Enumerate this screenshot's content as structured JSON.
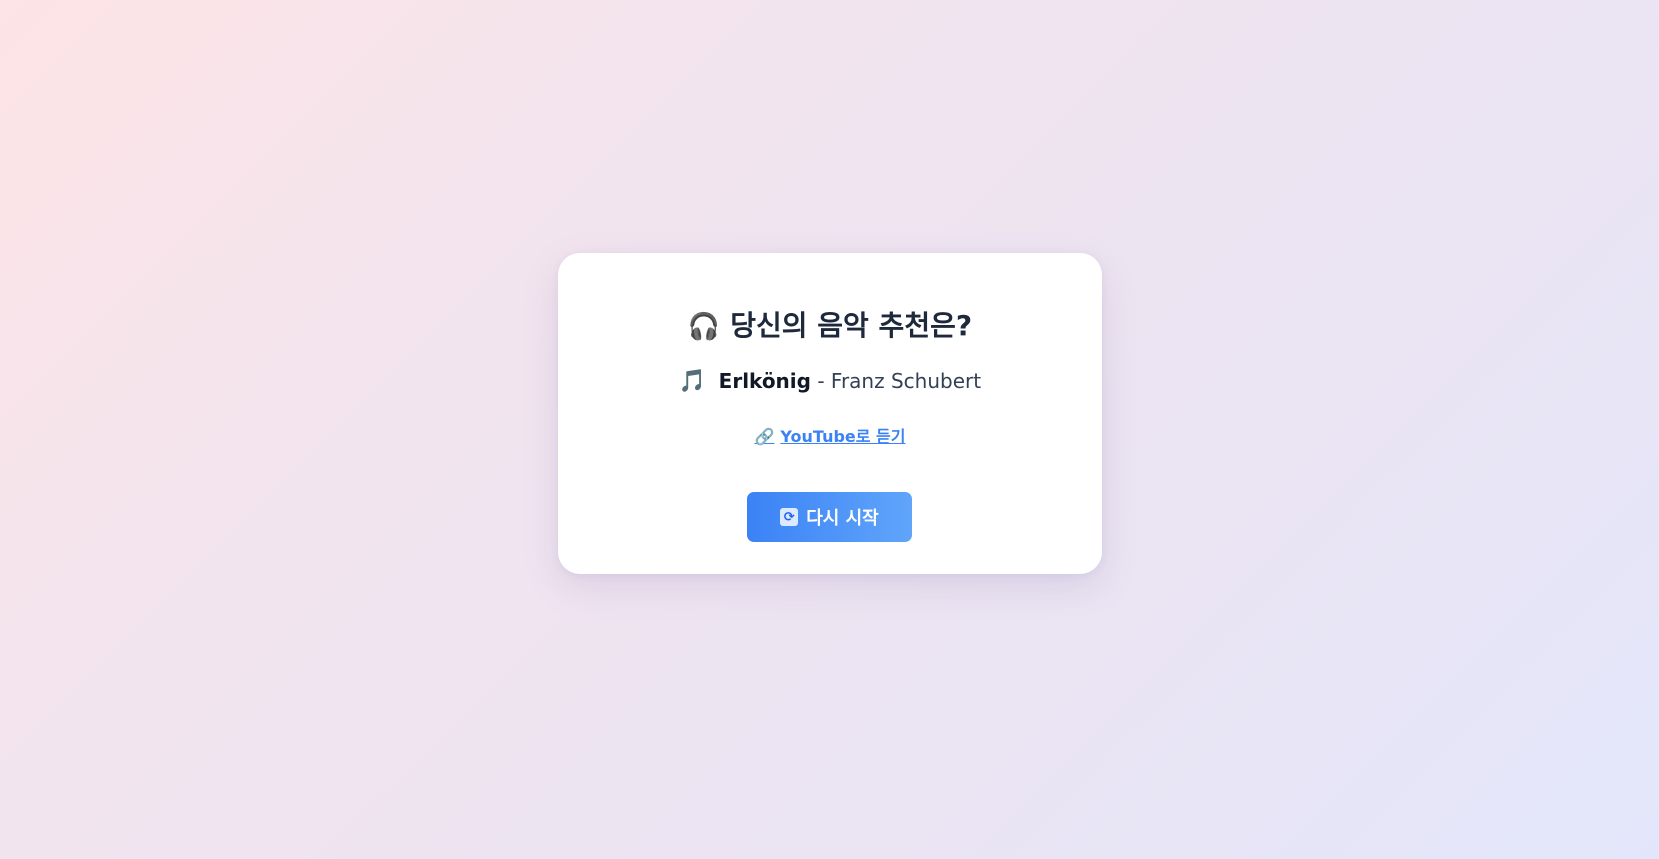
{
  "card": {
    "title_icon": "🎧",
    "title": "당신의 음악 추천은?",
    "song": {
      "icon": "🎵",
      "title": "Erlkönig",
      "separator": "-",
      "artist": "Franz Schubert"
    },
    "link": {
      "icon": "🔗",
      "label": "YouTube로 듣기"
    },
    "restart": {
      "icon": "🔄",
      "label": "다시 시작"
    }
  },
  "colors": {
    "accent": "#3b82f6",
    "accent_light": "#60a5fa",
    "title": "#1e293b",
    "background_start": "#fde4e6",
    "background_end": "#e3e6fb"
  }
}
